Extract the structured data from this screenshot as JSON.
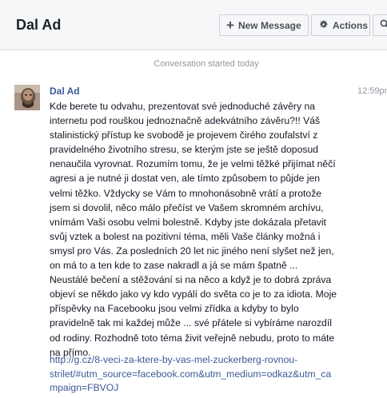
{
  "header": {
    "title": "Dal Ad",
    "new_message_label": "New Message",
    "actions_label": "Actions",
    "icons": {
      "new_message": "plus-icon",
      "actions": "gear-icon",
      "search": "search-icon"
    }
  },
  "conversation": {
    "started_text": "Conversation started today"
  },
  "message": {
    "sender": "Dal Ad",
    "time": "12:59pm",
    "lines": [
      "Kde berete tu odvahu, prezentovat své jednoduché závěry na",
      "internetu pod rouškou jednoznačně adekvátního závěru?!! Váš",
      "stalinistický přístup ke svobodě je projevem čirého zoufalství z",
      "pravidelného životního stresu, se kterým jste se ještě doposud",
      "nenaučila vyrovnat. Rozumím tomu, že je velmi těžké přijímat něčí",
      "agresi a je nutné ji dostat ven, ale tímto způsobem to půjde jen",
      "velmi těžko. Vždycky se Vám to mnohonásobně vrátí a protože",
      "jsem si dovolil, něco málo přečíst ve Vašem skromném archívu,",
      "vnímám Vaši osobu velmi bolestně. Kdyby jste dokázala přetavit",
      "svůj vztek a bolest na pozitivní téma, měli Vaše články možná i",
      "smysl pro Vás. Za posledních 20 let nic jiného není slyšet než jen,",
      "on má to a ten kde to zase nakradl a já se mám špatně ...",
      "Neustálé bečení a stěžování si na něco a když je to dobrá zpráva",
      "objeví se někdo jako vy kdo vypálí do světa co je to za idiota. Moje",
      "příspěvky na Facebooku jsou velmi zřídka a kdyby to bylo",
      "pravidelně tak mi každej může ... své přátele si vybíráme narozdíl",
      "od rodiny. Rozhodně toto téma živit veřejně nebudu, proto to máte",
      "na přímo."
    ],
    "link_lines": [
      "http://g.cz/8-veci-za-ktere-by-vas-mel-zuckerberg-rovnou-",
      "strilet/#utm_source=facebook.com&utm_medium=odkaz&utm_ca",
      "mpaign=FBVOJ"
    ]
  },
  "colors": {
    "header_bg": "#f6f7f8",
    "link": "#3b5998",
    "muted": "#9197a3",
    "text": "#141823"
  }
}
